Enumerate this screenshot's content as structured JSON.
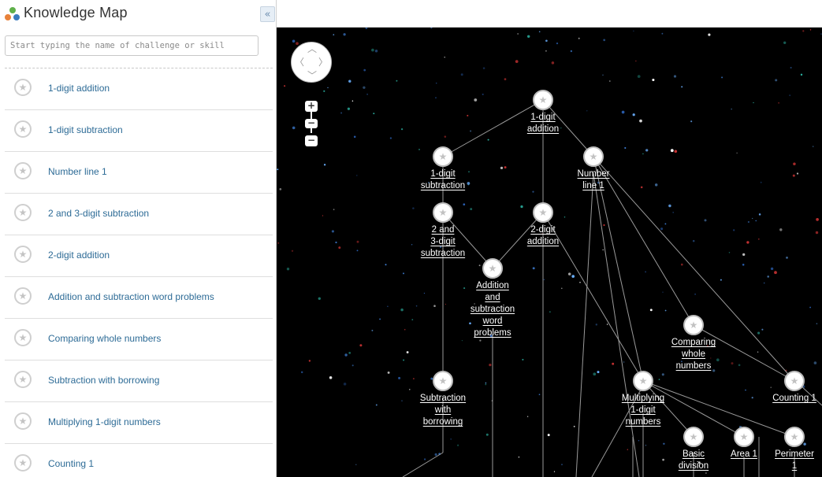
{
  "app": {
    "title": "Knowledge Map"
  },
  "search": {
    "placeholder": "Start typing the name of challenge or skill"
  },
  "sidebar": {
    "items": [
      {
        "label": "1-digit addition"
      },
      {
        "label": "1-digit subtraction"
      },
      {
        "label": "Number line 1"
      },
      {
        "label": "2 and 3-digit subtraction"
      },
      {
        "label": "2-digit addition"
      },
      {
        "label": "Addition and subtraction word problems"
      },
      {
        "label": "Comparing whole numbers"
      },
      {
        "label": "Subtraction with borrowing"
      },
      {
        "label": "Multiplying 1-digit numbers"
      },
      {
        "label": "Counting 1"
      }
    ]
  },
  "controls": {
    "zoom_in": "+",
    "zoom_out": "−",
    "zoom_minus": "−"
  },
  "map": {
    "nodes": [
      {
        "label": "1-digit\naddition"
      },
      {
        "label": "1-digit\nsubtraction"
      },
      {
        "label": "Number\nline 1"
      },
      {
        "label": "2 and\n3-digit\nsubtraction"
      },
      {
        "label": "2-digit\naddition"
      },
      {
        "label": "Addition\nand\nsubtraction\nword\nproblems"
      },
      {
        "label": "Comparing\nwhole\nnumbers"
      },
      {
        "label": "Subtraction\nwith\nborrowing"
      },
      {
        "label": "Multiplying\n1-digit\nnumbers"
      },
      {
        "label": "Counting 1"
      },
      {
        "label": "Basic\ndivision"
      },
      {
        "label": "Area 1"
      },
      {
        "label": "Perimeter\n1"
      }
    ]
  },
  "colors": {
    "accent": "#2d6b96",
    "map_background": "#000000",
    "logo_green": "#5fb04a",
    "logo_orange": "#e8823a",
    "logo_blue": "#3a7bbf"
  },
  "icons": {
    "logo": "knowledge-map-logo-icon",
    "collapse": "double-chevron-left-icon",
    "star": "star-icon",
    "pan": "pan-arrows-icon"
  }
}
